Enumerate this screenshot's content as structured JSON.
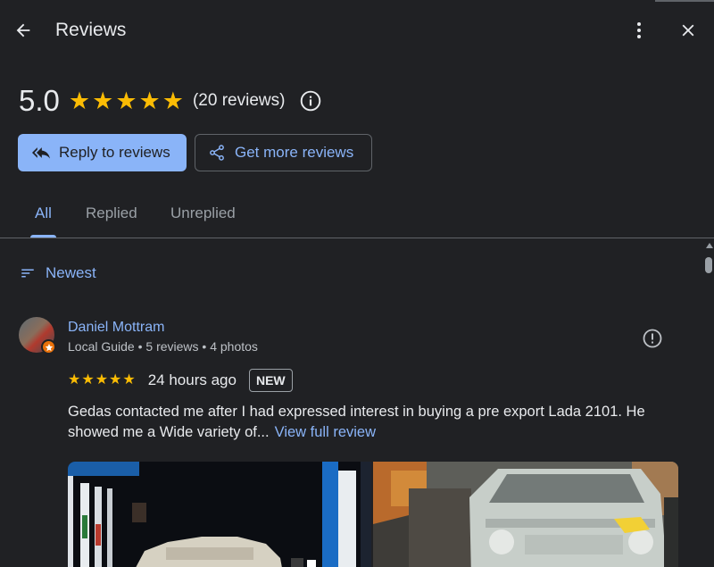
{
  "header": {
    "title": "Reviews",
    "back_icon": "arrow-left-icon",
    "more_icon": "more-vert-icon",
    "close_icon": "close-icon"
  },
  "summary": {
    "rating": "5.0",
    "stars": 5,
    "review_count": "(20 reviews)"
  },
  "actions": {
    "reply_label": "Reply to reviews",
    "get_more_label": "Get more reviews"
  },
  "tabs": [
    {
      "label": "All",
      "active": true
    },
    {
      "label": "Replied",
      "active": false
    },
    {
      "label": "Unreplied",
      "active": false
    }
  ],
  "sort": {
    "label": "Newest"
  },
  "reviews": [
    {
      "name": "Daniel Mottram",
      "meta": "Local Guide • 5 reviews • 4 photos",
      "stars": 5,
      "time": "24 hours ago",
      "badge": "NEW",
      "text": "Gedas contacted me after I had expressed interest in buying a pre export Lada 2101. He showed me a Wide variety of...",
      "view_full": "View full review",
      "photo_count": 2
    }
  ],
  "colors": {
    "background": "#202124",
    "accent": "#8ab4f8",
    "star": "#fbbc04",
    "text": "#e8eaed"
  }
}
